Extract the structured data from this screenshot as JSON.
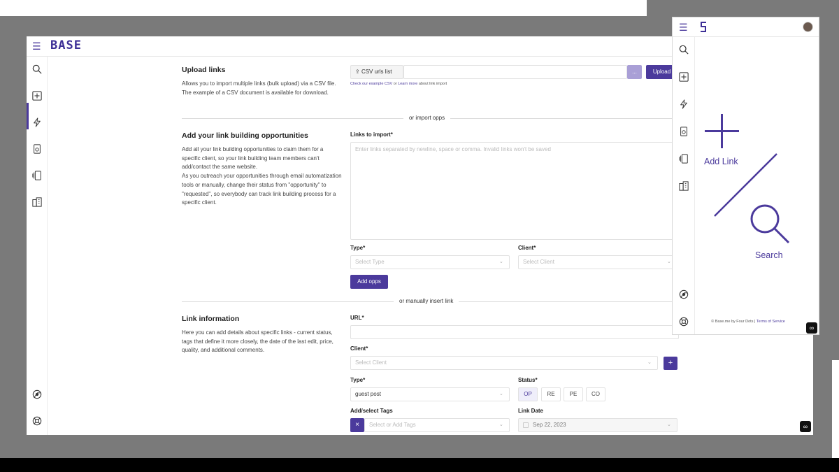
{
  "app": {
    "logo": "BASE"
  },
  "upload": {
    "title": "Upload links",
    "description": "Allows you to import multiple links (bulk upload) via a CSV file. The example of a CSV document is available for download.",
    "csv_button": "CSV urls list",
    "browse_button": "...",
    "upload_button": "Upload",
    "help_prefix": "Check our example CSV",
    "help_or": "or",
    "help_learn": "Learn more",
    "help_suffix": "about link import"
  },
  "divider_import": "or import opps",
  "opps": {
    "title": "Add your link building opportunities",
    "description": "Add all your link building opportunities to claim them for a specific client, so your link building team members can't add/contact the same website.\nAs you outreach your opportunities through email automatization tools or manually, change their status from \"opportunity\" to \"requested\", so everybody can track link building process for a specific client.",
    "links_label": "Links to import*",
    "links_placeholder": "Enter links separated by newline, space or comma. Invalid links won't be saved",
    "type_label": "Type*",
    "type_placeholder": "Select Type",
    "client_label": "Client*",
    "client_placeholder": "Select Client",
    "add_button": "Add opps"
  },
  "divider_manual": "or manually insert link",
  "link_info": {
    "title": "Link information",
    "description": "Here you can add details about specific links - current status, tags that define it more closely, the date of the last edit, price, quality, and additional comments.",
    "url_label": "URL*",
    "client_label": "Client*",
    "client_placeholder": "Select Client",
    "add_client_button": "+",
    "type_label": "Type*",
    "type_value": "guest post",
    "status_label": "Status*",
    "status_options": [
      "OP",
      "RE",
      "PE",
      "CO"
    ],
    "tags_label": "Add/select Tags",
    "tags_placeholder": "Select or Add Tags",
    "tags_clear": "×",
    "date_label": "Link Date",
    "date_value": "Sep 22, 2023"
  },
  "mobile": {
    "add_link": "Add Link",
    "search": "Search",
    "footer_prefix": "© Base.me by Four Dots |",
    "footer_terms": "Terms of Service"
  },
  "colors": {
    "accent": "#4b3a9c",
    "background": "#7a7a7a"
  }
}
